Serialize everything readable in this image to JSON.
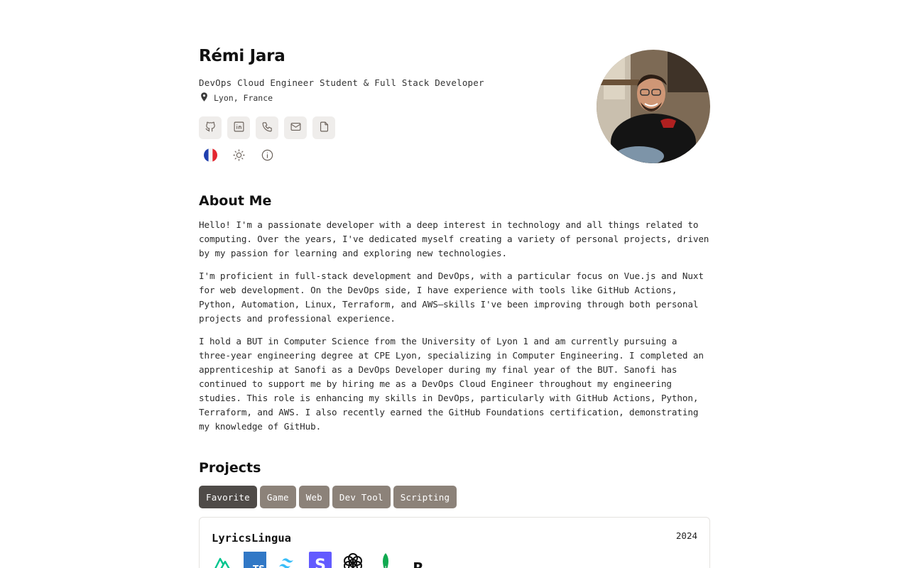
{
  "header": {
    "name": "Rémi Jara",
    "subtitle": "DevOps Cloud Engineer Student & Full Stack Developer",
    "location": "Lyon, France"
  },
  "contacts": [
    {
      "icon": "github-icon"
    },
    {
      "icon": "linkedin-icon"
    },
    {
      "icon": "phone-icon"
    },
    {
      "icon": "mail-icon"
    },
    {
      "icon": "document-icon"
    }
  ],
  "settings": [
    {
      "icon": "france-flag-icon"
    },
    {
      "icon": "sun-icon"
    },
    {
      "icon": "info-icon"
    }
  ],
  "about": {
    "title": "About Me",
    "paragraphs": [
      "Hello! I'm a passionate developer with a deep interest in technology and all things related to computing. Over the years, I've dedicated myself creating a variety of personal projects, driven by my passion for learning and exploring new technologies.",
      "I'm proficient in full-stack development and DevOps, with a particular focus on Vue.js and Nuxt for web development. On the DevOps side, I have experience with tools like GitHub Actions, Python, Automation, Linux, Terraform, and AWS—skills I've been improving through both personal projects and professional experience.",
      "I hold a BUT in Computer Science from the University of Lyon 1 and am currently pursuing a three-year engineering degree at CPE Lyon, specializing in Computer Engineering. I completed an apprenticeship at Sanofi as a DevOps Developer during my final year of the BUT. Sanofi has continued to support me by hiring me as a DevOps Cloud Engineer throughout my engineering studies. This role is enhancing my skills in DevOps, particularly with GitHub Actions, Python, Terraform, and AWS. I also recently earned the GitHub Foundations certification, demonstrating my knowledge of GitHub."
    ]
  },
  "projects": {
    "title": "Projects",
    "filters": [
      "Favorite",
      "Game",
      "Web",
      "Dev Tool",
      "Scripting"
    ],
    "active_filter": "Favorite",
    "items": [
      {
        "title": "LyricsLingua",
        "year": "2024",
        "tech_icons": [
          "nuxt-icon",
          "typescript-icon",
          "tailwind-icon",
          "stripe-icon",
          "openai-icon",
          "mongodb-icon",
          "resend-icon"
        ],
        "tech_labels": {
          "typescript": "TS",
          "stripe": "S",
          "resend": "R"
        }
      }
    ]
  },
  "colors": {
    "accent": "#8c8279",
    "accent_active": "#4f4b48",
    "button_bg": "#efedeb",
    "icon": "#6b625b"
  }
}
